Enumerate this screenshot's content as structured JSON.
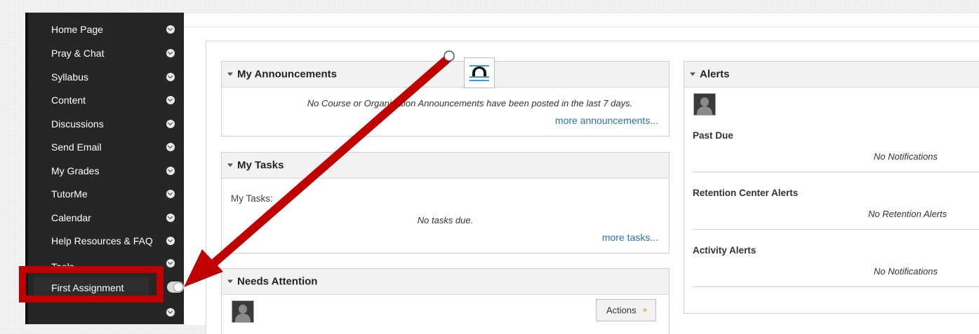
{
  "sidebar": {
    "items": [
      {
        "label": "Home Page"
      },
      {
        "label": "Pray & Chat"
      },
      {
        "label": "Syllabus"
      },
      {
        "label": "Content"
      },
      {
        "label": "Discussions"
      },
      {
        "label": "Send Email"
      },
      {
        "label": "My Grades"
      },
      {
        "label": "TutorMe"
      },
      {
        "label": "Calendar"
      },
      {
        "label": "Help Resources & FAQ"
      },
      {
        "label": "Tools"
      },
      {
        "label": "First Assignment"
      }
    ]
  },
  "announcements": {
    "title": "My Announcements",
    "empty_message": "No Course or Organization Announcements have been posted in the last 7 days.",
    "more_link": "more announcements..."
  },
  "tasks": {
    "title": "My Tasks",
    "label": "My Tasks:",
    "empty_message": "No tasks due.",
    "more_link": "more tasks..."
  },
  "needs_attention": {
    "title": "Needs Attention",
    "actions_label": "Actions"
  },
  "alerts": {
    "title": "Alerts",
    "sections": [
      {
        "title": "Past Due",
        "message": "No Notifications"
      },
      {
        "title": "Retention Center Alerts",
        "message": "No Retention Alerts"
      },
      {
        "title": "Activity Alerts",
        "message": "No Notifications"
      }
    ]
  },
  "colors": {
    "sidebar_bg": "#262626",
    "highlight_red": "#c00000",
    "link_blue": "#2a6fb0"
  }
}
